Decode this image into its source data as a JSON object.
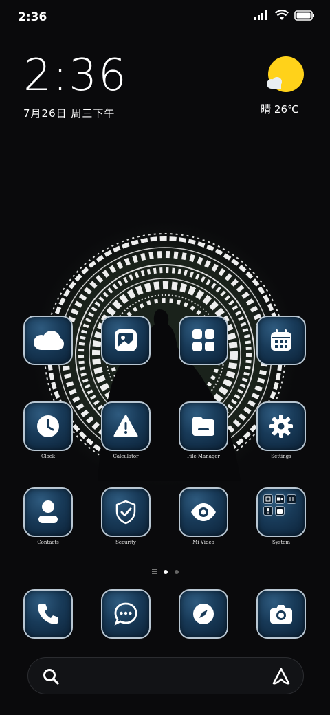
{
  "status_bar": {
    "time": "2:36"
  },
  "clock_widget": {
    "time": "2:36",
    "date": "7月26日 周三下午"
  },
  "weather": {
    "text": "晴 26℃"
  },
  "apps_row1": [
    {
      "name": "Cloud",
      "icon": "cloud-icon",
      "label": ""
    },
    {
      "name": "Gallery",
      "icon": "image-icon",
      "label": ""
    },
    {
      "name": "Apps",
      "icon": "apps-grid-icon",
      "label": ""
    },
    {
      "name": "Calendar",
      "icon": "calendar-icon",
      "label": ""
    }
  ],
  "apps_row2": [
    {
      "label": "Clock",
      "icon": "clock-icon"
    },
    {
      "label": "Calculator",
      "icon": "warning-triangle-icon"
    },
    {
      "label": "File Manager",
      "icon": "folder-icon"
    },
    {
      "label": "Settings",
      "icon": "gear-icon"
    }
  ],
  "apps_row3": [
    {
      "label": "Contacts",
      "icon": "person-icon"
    },
    {
      "label": "Security",
      "icon": "shield-check-icon"
    },
    {
      "label": "Mi Video",
      "icon": "eye-icon"
    },
    {
      "label": "System",
      "icon": "folder-grid-icon"
    }
  ],
  "dock": [
    {
      "name": "Phone",
      "icon": "phone-icon"
    },
    {
      "name": "Messages",
      "icon": "chat-bubble-icon"
    },
    {
      "name": "Browser",
      "icon": "compass-icon"
    },
    {
      "name": "Camera",
      "icon": "camera-icon"
    }
  ],
  "page_indicator": {
    "pages": 2,
    "active": 0
  },
  "search": {
    "placeholder": ""
  },
  "colors": {
    "accent": "#ffd21a",
    "tile_border": "#b8c6d2",
    "tile_bg": "#183a58"
  }
}
